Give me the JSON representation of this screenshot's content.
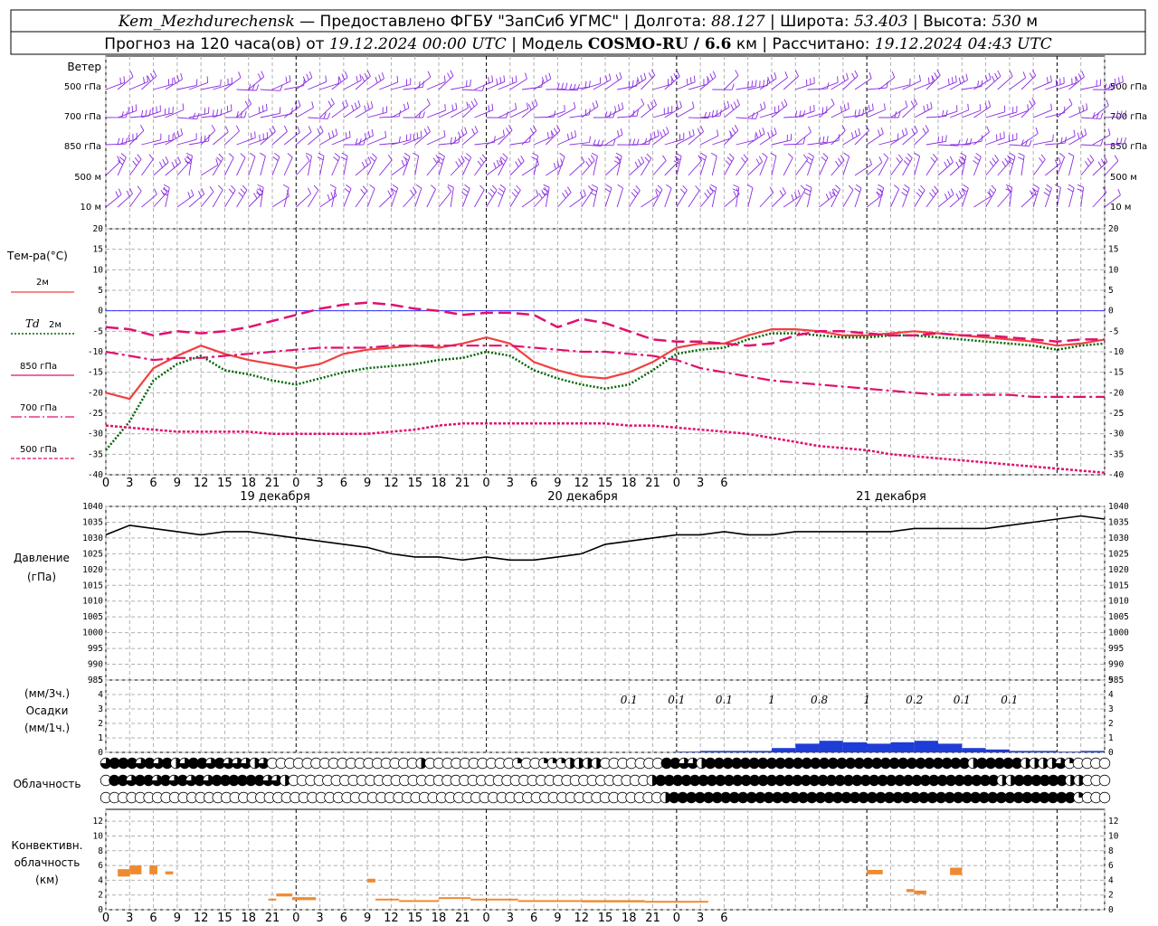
{
  "header": {
    "station": "Kem_Mezhdurechensk",
    "provided_by": "— Предоставлено ФГБУ \"ЗапСиб УГМС\"",
    "lon_label": "Долгота:",
    "lon": "88.127",
    "lat_label": "Широта:",
    "lat": "53.403",
    "alt_label": "Высота:",
    "alt": "530",
    "alt_unit": "м",
    "forecast_label": "Прогноз на 120 часа(ов) от",
    "forecast_start": "19.12.2024 00:00 UTC",
    "model_label": "Модель",
    "model": "COSMO-RU / 6.6",
    "model_unit": "км",
    "computed_label": "Рассчитано:",
    "computed": "19.12.2024 04:43 UTC"
  },
  "colors": {
    "wind": "#8a2be2",
    "t2m": "#f04040",
    "td2m": "#006400",
    "t850": "#e0106e",
    "t700": "#e0106e",
    "t500": "#e0106e",
    "zero_line": "#3030ff",
    "pressure": "#000000",
    "precip": "#1e3cd6",
    "convective": "#f08a30"
  },
  "time_axis": {
    "hours": [
      "0",
      "3",
      "6",
      "9",
      "12",
      "15",
      "18",
      "21",
      "0",
      "3",
      "6",
      "9",
      "12",
      "15",
      "18",
      "21",
      "0",
      "3",
      "6",
      "9",
      "12",
      "15",
      "18",
      "21",
      "0",
      "3",
      "6"
    ],
    "days": [
      "19 декабря",
      "20 декабря",
      "21 декабря"
    ]
  },
  "wind_panel": {
    "title": "Ветер",
    "levels": [
      "500 гПа",
      "700 гПа",
      "850 гПа",
      "500 м",
      "10  м"
    ],
    "levels_right": [
      "500 гПа",
      "700 гПа",
      "850 гПа",
      "500 м",
      "10  м"
    ]
  },
  "temp_panel": {
    "title": "Тем-ра(°C)",
    "legend": [
      {
        "label": "2м",
        "style": "solid"
      },
      {
        "label": "Td",
        "label2": "2м",
        "style": "dotted"
      },
      {
        "label": "850 гПа",
        "style": "longdash"
      },
      {
        "label": "700 гПа",
        "style": "dashdot"
      },
      {
        "label": "500 гПа",
        "style": "shortdash"
      }
    ]
  },
  "pressure_panel": {
    "title": "Давление",
    "unit": "(гПа)"
  },
  "precip_panel": {
    "unit_top": "(мм/3ч.)",
    "title": "Осадки",
    "unit_bottom": "(мм/1ч.)",
    "annotations": [
      "0.1",
      "0.1",
      "0.1",
      "1",
      "0.8",
      "1",
      "0.2",
      "0.1",
      "0.1"
    ]
  },
  "cloud_panel": {
    "title": "Облачность"
  },
  "conv_panel": {
    "title1": "Конвективн.",
    "title2": "облачность",
    "unit": "(км)"
  },
  "chart_data": [
    {
      "type": "line",
      "name": "temperature",
      "x_hours": [
        0,
        3,
        6,
        9,
        12,
        15,
        18,
        21,
        24,
        27,
        30,
        33,
        36,
        39,
        42,
        45,
        48,
        51,
        54,
        57,
        60,
        63,
        66,
        69,
        72,
        75,
        78,
        81,
        84,
        87,
        90,
        93,
        96,
        99,
        102,
        105,
        108,
        111,
        114,
        117,
        120,
        123,
        126
      ],
      "series": [
        {
          "name": "2м",
          "values": [
            -20,
            -21.5,
            -14,
            -11,
            -8.5,
            -10.5,
            -12,
            -13,
            -14,
            -13,
            -10.5,
            -9.5,
            -9,
            -8.5,
            -9,
            -8,
            -6.5,
            -8,
            -12.5,
            -14.5,
            -16,
            -16.5,
            -15,
            -12.5,
            -9,
            -8,
            -8,
            -6,
            -4.5,
            -4.5,
            -5,
            -6,
            -6,
            -5.5,
            -5,
            -5.5,
            -6,
            -6.5,
            -7,
            -7.5,
            -8.5,
            -8,
            -7
          ]
        },
        {
          "name": "Td 2м",
          "values": [
            -34,
            -27,
            -17,
            -13,
            -11,
            -14.5,
            -15.5,
            -17,
            -18,
            -16.5,
            -15,
            -14,
            -13.5,
            -13,
            -12,
            -11.5,
            -10,
            -11,
            -14.5,
            -16.5,
            -18,
            -19,
            -18,
            -14.5,
            -10.5,
            -9.5,
            -9,
            -7,
            -5.5,
            -5.5,
            -6,
            -6.5,
            -6.5,
            -6,
            -6,
            -6.5,
            -7,
            -7.5,
            -8,
            -8.5,
            -9.5,
            -8.5,
            -8
          ]
        },
        {
          "name": "850 гПа",
          "values": [
            -4,
            -4.5,
            -6,
            -5,
            -5.5,
            -5,
            -4,
            -2.5,
            -1,
            0.5,
            1.5,
            2,
            1.5,
            0.5,
            0,
            -1,
            -0.5,
            -0.5,
            -1,
            -4,
            -2,
            -3,
            -5,
            -7,
            -7.5,
            -7.5,
            -8,
            -8.5,
            -8,
            -6,
            -5,
            -5,
            -5.5,
            -6,
            -6,
            -5.5,
            -6,
            -6,
            -6.5,
            -7,
            -7.5,
            -7,
            -7
          ]
        },
        {
          "name": "700 гПа",
          "values": [
            -10,
            -11,
            -12,
            -11.5,
            -11.5,
            -11,
            -10.5,
            -10,
            -9.5,
            -9,
            -9,
            -9,
            -8.5,
            -8.5,
            -8.5,
            -8.5,
            -8.5,
            -8.5,
            -9,
            -9.5,
            -10,
            -10,
            -10.5,
            -11,
            -12,
            -14,
            -15,
            -16,
            -17,
            -17.5,
            -18,
            -18.5,
            -19,
            -19.5,
            -20,
            -20.5,
            -20.5,
            -20.5,
            -20.5,
            -21,
            -21,
            -21,
            -21
          ]
        },
        {
          "name": "500 гПа",
          "values": [
            -28,
            -28.5,
            -29,
            -29.5,
            -29.5,
            -29.5,
            -29.5,
            -30,
            -30,
            -30,
            -30,
            -30,
            -29.5,
            -29,
            -28,
            -27.5,
            -27.5,
            -27.5,
            -27.5,
            -27.5,
            -27.5,
            -27.5,
            -28,
            -28,
            -28.5,
            -29,
            -29.5,
            -30,
            -31,
            -32,
            -33,
            -33.5,
            -34,
            -35,
            -35.5,
            -36,
            -36.5,
            -37,
            -37.5,
            -38,
            -38.5,
            -39,
            -39.5
          ]
        }
      ],
      "ylim": [
        -40,
        20
      ],
      "yticks": [
        -40,
        -35,
        -30,
        -25,
        -20,
        -15,
        -10,
        -5,
        0,
        5,
        10,
        15,
        20
      ],
      "grid": true
    },
    {
      "type": "line",
      "name": "pressure",
      "x_hours": [
        0,
        3,
        6,
        9,
        12,
        15,
        18,
        21,
        24,
        27,
        30,
        33,
        36,
        39,
        42,
        45,
        48,
        51,
        54,
        57,
        60,
        63,
        66,
        69,
        72,
        75,
        78,
        81,
        84,
        87,
        90,
        93,
        96,
        99,
        102,
        105,
        108,
        111,
        114,
        117,
        120,
        123,
        126
      ],
      "values": [
        1031,
        1034,
        1033,
        1032,
        1031,
        1032,
        1032,
        1031,
        1030,
        1029,
        1028,
        1027,
        1025,
        1024,
        1024,
        1023,
        1024,
        1023,
        1023,
        1024,
        1025,
        1028,
        1029,
        1030,
        1031,
        1031,
        1032,
        1031,
        1031,
        1032,
        1032,
        1032,
        1032,
        1032,
        1033,
        1033,
        1033,
        1033,
        1034,
        1035,
        1036,
        1037,
        1036
      ],
      "ylim": [
        985,
        1040
      ],
      "yticks": [
        985,
        990,
        995,
        1000,
        1005,
        1010,
        1015,
        1020,
        1025,
        1030,
        1035,
        1040
      ],
      "grid": true
    },
    {
      "type": "bar",
      "name": "precipitation",
      "x_hours": [
        72,
        75,
        78,
        81,
        84,
        87,
        90,
        93,
        96,
        99,
        102,
        105,
        108,
        111,
        114,
        117,
        120,
        123
      ],
      "values": [
        0.05,
        0.1,
        0.1,
        0.1,
        0.3,
        0.6,
        0.8,
        0.7,
        0.6,
        0.7,
        0.8,
        0.6,
        0.3,
        0.2,
        0.1,
        0.1,
        0.05,
        0.1
      ],
      "ylim": [
        0,
        5
      ],
      "yticks": [
        0,
        1,
        2,
        3,
        4,
        5
      ],
      "grid": true
    },
    {
      "type": "table",
      "name": "cloudiness",
      "rows": [
        "high",
        "mid",
        "low"
      ],
      "cover_high": [
        3,
        4,
        4,
        4,
        3,
        4,
        3,
        4,
        2,
        3,
        4,
        4,
        3,
        4,
        3,
        3,
        3,
        2,
        3,
        0,
        0,
        0,
        0,
        0,
        0,
        0,
        0,
        0,
        0,
        0,
        0,
        0,
        0,
        0,
        0,
        0,
        2,
        0,
        0,
        0,
        0,
        0,
        0,
        0,
        0,
        0,
        0,
        1,
        0,
        0,
        1,
        1,
        1,
        2,
        2,
        2,
        2,
        0,
        0,
        0,
        0,
        0,
        0,
        0,
        4,
        4,
        3,
        3,
        2,
        4,
        4,
        4,
        4,
        4,
        4,
        4,
        4,
        4,
        4,
        4,
        4,
        4,
        4,
        4,
        4,
        4,
        4,
        4,
        4,
        4,
        4,
        4,
        4,
        4,
        4,
        4,
        4,
        4,
        4,
        2,
        4,
        4,
        4,
        4,
        4,
        2,
        2,
        2,
        2,
        3,
        1,
        0,
        0,
        0,
        0
      ],
      "cover_mid": [
        0,
        4,
        4,
        3,
        4,
        4,
        3,
        4,
        3,
        4,
        3,
        4,
        3,
        4,
        4,
        4,
        4,
        4,
        4,
        3,
        3,
        2,
        0,
        0,
        0,
        0,
        0,
        0,
        0,
        0,
        0,
        0,
        0,
        0,
        0,
        0,
        0,
        0,
        0,
        0,
        0,
        0,
        0,
        0,
        0,
        0,
        0,
        0,
        0,
        0,
        0,
        0,
        0,
        0,
        0,
        0,
        0,
        0,
        0,
        0,
        0,
        0,
        0,
        0,
        2,
        4,
        4,
        4,
        4,
        4,
        4,
        4,
        4,
        4,
        4,
        4,
        4,
        4,
        4,
        4,
        4,
        4,
        4,
        4,
        4,
        4,
        4,
        4,
        4,
        4,
        4,
        4,
        4,
        4,
        4,
        4,
        4,
        4,
        4,
        4,
        4,
        4,
        4,
        4,
        4,
        2,
        2,
        4,
        4,
        4,
        4,
        4,
        4,
        2,
        2,
        0,
        0,
        0
      ],
      "cover_low": [
        0,
        0,
        0,
        0,
        0,
        0,
        0,
        0,
        0,
        0,
        0,
        0,
        0,
        0,
        0,
        0,
        0,
        0,
        0,
        0,
        0,
        0,
        0,
        0,
        0,
        0,
        0,
        0,
        0,
        0,
        0,
        0,
        0,
        0,
        0,
        0,
        0,
        0,
        0,
        0,
        0,
        0,
        0,
        0,
        0,
        0,
        0,
        0,
        0,
        0,
        0,
        0,
        0,
        0,
        0,
        0,
        0,
        0,
        0,
        0,
        0,
        0,
        0,
        0,
        0,
        2,
        4,
        4,
        4,
        4,
        4,
        4,
        4,
        4,
        4,
        4,
        4,
        4,
        4,
        4,
        4,
        4,
        4,
        4,
        4,
        4,
        4,
        4,
        4,
        4,
        4,
        4,
        4,
        4,
        4,
        4,
        4,
        4,
        4,
        4,
        4,
        4,
        4,
        4,
        4,
        4,
        4,
        4,
        4,
        4,
        4,
        4,
        4,
        1,
        0,
        0,
        0
      ]
    },
    {
      "type": "bar",
      "name": "convective_cloud",
      "segments_km": [
        {
          "h0": 1.5,
          "h1": 3,
          "base": 4.5,
          "top": 5.5
        },
        {
          "h0": 3,
          "h1": 4.5,
          "base": 4.8,
          "top": 6.0
        },
        {
          "h0": 5.5,
          "h1": 6.5,
          "base": 4.8,
          "top": 6.0
        },
        {
          "h0": 7.5,
          "h1": 8.5,
          "base": 4.8,
          "top": 5.2
        },
        {
          "h0": 20.5,
          "h1": 21.5,
          "base": 1.3,
          "top": 1.5
        },
        {
          "h0": 21.5,
          "h1": 23.5,
          "base": 1.8,
          "top": 2.2
        },
        {
          "h0": 23.5,
          "h1": 26.5,
          "base": 1.3,
          "top": 1.7
        },
        {
          "h0": 33,
          "h1": 34,
          "base": 3.7,
          "top": 4.2
        },
        {
          "h0": 34,
          "h1": 37,
          "base": 1.3,
          "top": 1.5
        },
        {
          "h0": 37,
          "h1": 42,
          "base": 1.1,
          "top": 1.3
        },
        {
          "h0": 42,
          "h1": 46,
          "base": 1.5,
          "top": 1.7
        },
        {
          "h0": 46,
          "h1": 52,
          "base": 1.3,
          "top": 1.5
        },
        {
          "h0": 52,
          "h1": 60,
          "base": 1.1,
          "top": 1.3
        },
        {
          "h0": 60,
          "h1": 68,
          "base": 1.0,
          "top": 1.3
        },
        {
          "h0": 68,
          "h1": 76,
          "base": 1.0,
          "top": 1.2
        },
        {
          "h0": 96,
          "h1": 98,
          "base": 4.8,
          "top": 5.4
        },
        {
          "h0": 101,
          "h1": 102,
          "base": 2.4,
          "top": 2.8
        },
        {
          "h0": 102,
          "h1": 103.5,
          "base": 2.1,
          "top": 2.6
        },
        {
          "h0": 106.5,
          "h1": 108,
          "base": 4.7,
          "top": 5.7
        }
      ],
      "ylim": [
        0,
        13
      ],
      "yticks": [
        0,
        2,
        4,
        6,
        8,
        10,
        12
      ],
      "grid": true
    }
  ]
}
